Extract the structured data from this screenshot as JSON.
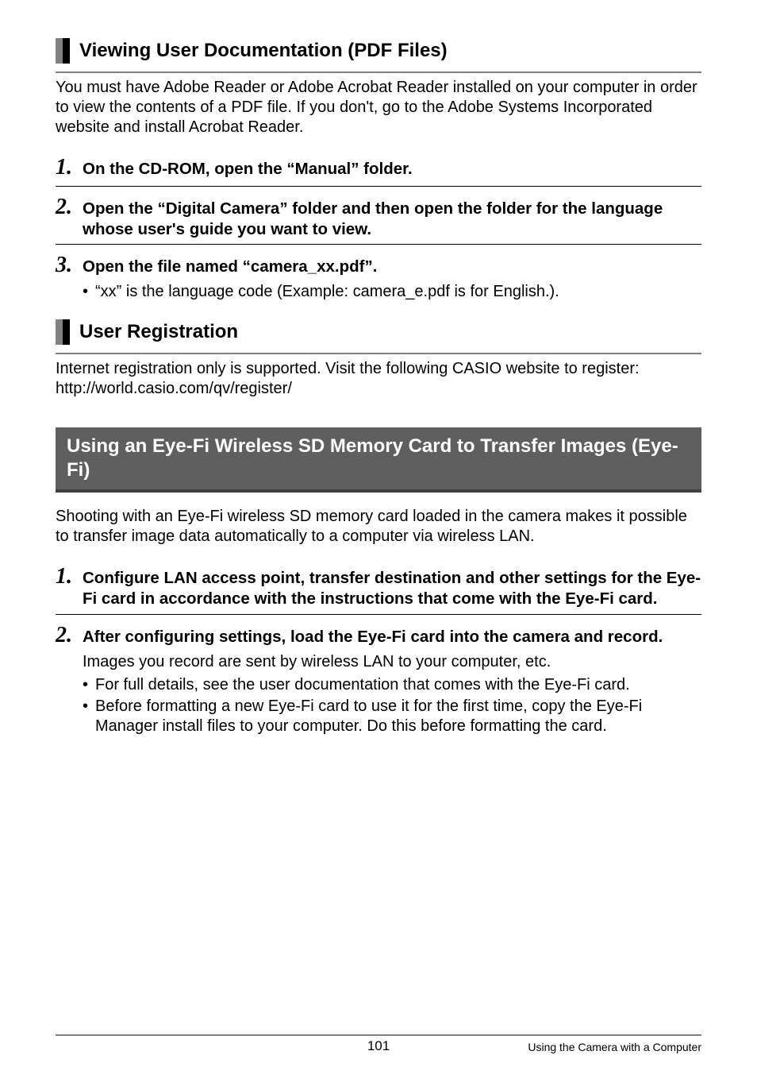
{
  "section1": {
    "title": "Viewing User Documentation (PDF Files)",
    "intro": "You must have Adobe Reader or Adobe Acrobat Reader installed on your computer in order to view the contents of a PDF file. If you don't, go to the Adobe Systems Incorporated website and install Acrobat Reader.",
    "steps": [
      {
        "num": "1.",
        "text": "On the CD-ROM, open the “Manual” folder."
      },
      {
        "num": "2.",
        "text": "Open the “Digital Camera” folder and then open the folder for the language whose user's guide you want to view."
      },
      {
        "num": "3.",
        "text": "Open the file named “camera_xx.pdf”."
      }
    ],
    "step3_bullet": "“xx” is the language code (Example: camera_e.pdf is for English.)."
  },
  "section2": {
    "title": "User Registration",
    "para": "Internet registration only is supported. Visit the following CASIO website to register: http://world.casio.com/qv/register/"
  },
  "section3": {
    "title": "Using an Eye-Fi Wireless SD Memory Card to Transfer Images (Eye-Fi)",
    "intro": "Shooting with an Eye-Fi wireless SD memory card loaded in the camera makes it possible to transfer image data automatically to a computer via wireless LAN.",
    "steps": [
      {
        "num": "1.",
        "text": "Configure LAN access point, transfer destination and other settings for the Eye-Fi card in accordance with the instructions that come with the Eye-Fi card."
      },
      {
        "num": "2.",
        "text": "After configuring settings, load the Eye-Fi card into the camera and record."
      }
    ],
    "step2_body": "Images you record are sent by wireless LAN to your computer, etc.",
    "step2_bullets": [
      "For full details, see the user documentation that comes with the Eye-Fi card.",
      "Before formatting a new Eye-Fi card to use it for the first time, copy the Eye-Fi Manager install files to your computer. Do this before formatting the card."
    ]
  },
  "footer": {
    "page": "101",
    "right": "Using the Camera with a Computer"
  }
}
